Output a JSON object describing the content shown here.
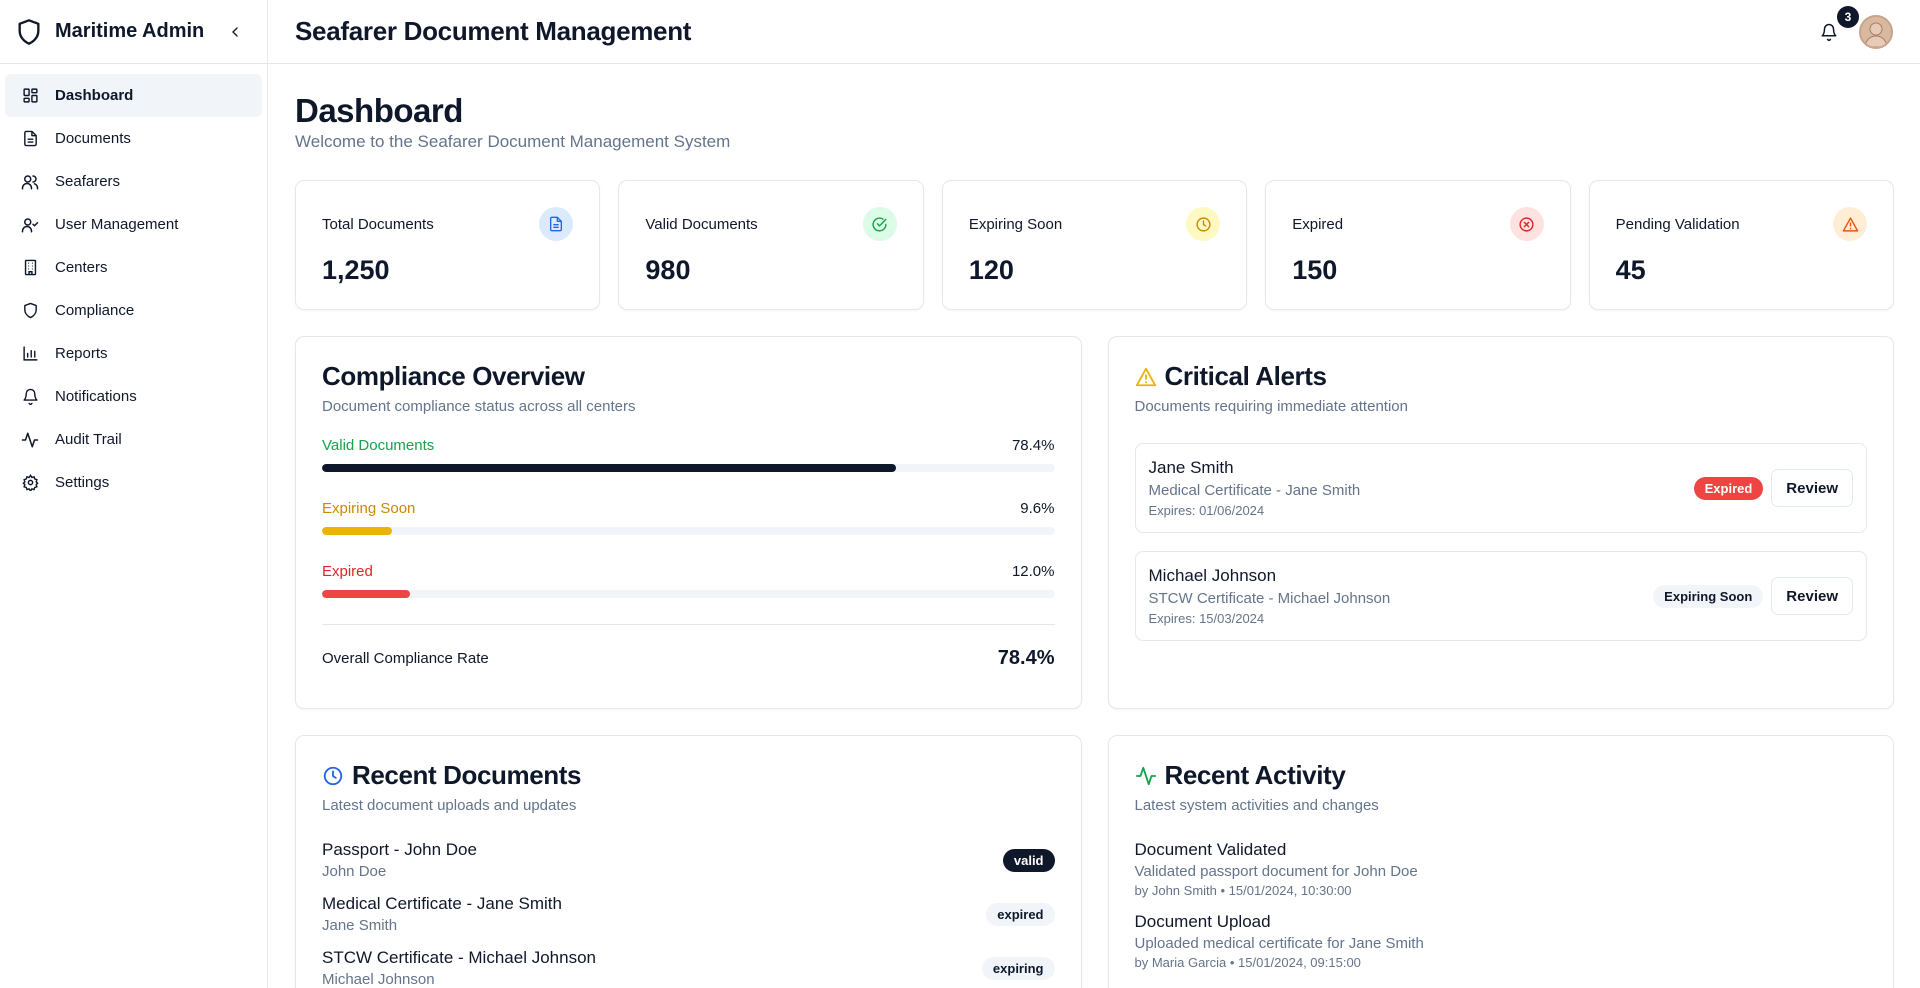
{
  "app": {
    "brand": "Maritime Admin",
    "page_title": "Seafarer Document Management"
  },
  "sidebar": {
    "items": [
      {
        "label": "Dashboard",
        "icon": "dashboard-icon",
        "active": true
      },
      {
        "label": "Documents",
        "icon": "document-icon"
      },
      {
        "label": "Seafarers",
        "icon": "users-icon"
      },
      {
        "label": "User Management",
        "icon": "user-check-icon"
      },
      {
        "label": "Centers",
        "icon": "building-icon"
      },
      {
        "label": "Compliance",
        "icon": "shield-icon"
      },
      {
        "label": "Reports",
        "icon": "bar-chart-icon"
      },
      {
        "label": "Notifications",
        "icon": "bell-icon"
      },
      {
        "label": "Audit Trail",
        "icon": "activity-icon"
      },
      {
        "label": "Settings",
        "icon": "gear-icon"
      }
    ]
  },
  "header": {
    "notification_count": "3"
  },
  "dashboard": {
    "title": "Dashboard",
    "subtitle": "Welcome to the Seafarer Document Management System"
  },
  "stats": [
    {
      "label": "Total Documents",
      "value": "1,250",
      "icon": "file-text-icon",
      "bg": "#dbeafe",
      "fg": "#2563eb"
    },
    {
      "label": "Valid Documents",
      "value": "980",
      "icon": "check-circle-icon",
      "bg": "#dcfce7",
      "fg": "#16a34a"
    },
    {
      "label": "Expiring Soon",
      "value": "120",
      "icon": "clock-icon",
      "bg": "#fef9c3",
      "fg": "#ca8a04"
    },
    {
      "label": "Expired",
      "value": "150",
      "icon": "x-circle-icon",
      "bg": "#fee2e2",
      "fg": "#dc2626"
    },
    {
      "label": "Pending Validation",
      "value": "45",
      "icon": "warning-icon",
      "bg": "#ffedd5",
      "fg": "#ea580c"
    }
  ],
  "compliance": {
    "title": "Compliance Overview",
    "subtitle": "Document compliance status across all centers",
    "rows": [
      {
        "label": "Valid Documents",
        "pct_text": "78.4%",
        "pct": 78.4,
        "label_color": "#16a34a",
        "bar_color": "#0f172a"
      },
      {
        "label": "Expiring Soon",
        "pct_text": "9.6%",
        "pct": 9.6,
        "label_color": "#ca8a04",
        "bar_color": "#eab308"
      },
      {
        "label": "Expired",
        "pct_text": "12.0%",
        "pct": 12.0,
        "label_color": "#dc2626",
        "bar_color": "#ef4444"
      }
    ],
    "overall_label": "Overall Compliance Rate",
    "overall_value": "78.4%"
  },
  "alerts": {
    "title": "Critical Alerts",
    "subtitle": "Documents requiring immediate attention",
    "items": [
      {
        "name": "Jane Smith",
        "doc": "Medical Certificate - Jane Smith",
        "expires": "Expires: 01/06/2024",
        "status": "Expired",
        "button": "Review"
      },
      {
        "name": "Michael Johnson",
        "doc": "STCW Certificate - Michael Johnson",
        "expires": "Expires: 15/03/2024",
        "status": "Expiring Soon",
        "button": "Review"
      }
    ]
  },
  "recent_documents": {
    "title": "Recent Documents",
    "subtitle": "Latest document uploads and updates",
    "items": [
      {
        "name": "Passport - John Doe",
        "person": "John Doe",
        "status": "valid"
      },
      {
        "name": "Medical Certificate - Jane Smith",
        "person": "Jane Smith",
        "status": "expired"
      },
      {
        "name": "STCW Certificate - Michael Johnson",
        "person": "Michael Johnson",
        "status": "expiring"
      }
    ]
  },
  "recent_activity": {
    "title": "Recent Activity",
    "subtitle": "Latest system activities and changes",
    "items": [
      {
        "title": "Document Validated",
        "desc": "Validated passport document for John Doe",
        "meta": "by John Smith • 15/01/2024, 10:30:00"
      },
      {
        "title": "Document Upload",
        "desc": "Uploaded medical certificate for Jane Smith",
        "meta": "by Maria Garcia • 15/01/2024, 09:15:00"
      }
    ]
  },
  "colors": {
    "accent": "#0f172a",
    "muted": "#64748b",
    "border": "#e5e7eb"
  }
}
